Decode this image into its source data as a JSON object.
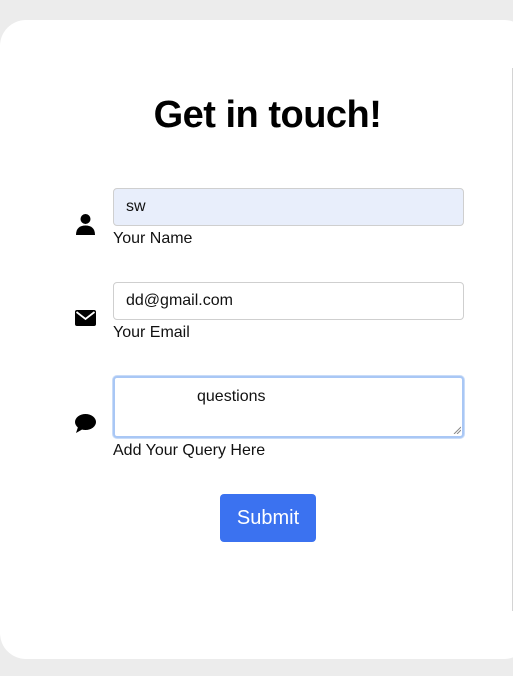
{
  "form": {
    "title": "Get in touch!",
    "name": {
      "value": "sw",
      "label": "Your Name",
      "icon": "user-icon"
    },
    "email": {
      "value": "dd@gmail.com",
      "label": "Your Email",
      "icon": "envelope-icon"
    },
    "query": {
      "value": "questions",
      "label": "Add Your Query Here",
      "icon": "comment-icon"
    },
    "submit_label": "Submit"
  },
  "colors": {
    "background": "#ececec",
    "card": "#ffffff",
    "submit": "#3b72f0",
    "autofill": "#e8eefb",
    "focus_ring": "#a9c7f5"
  }
}
